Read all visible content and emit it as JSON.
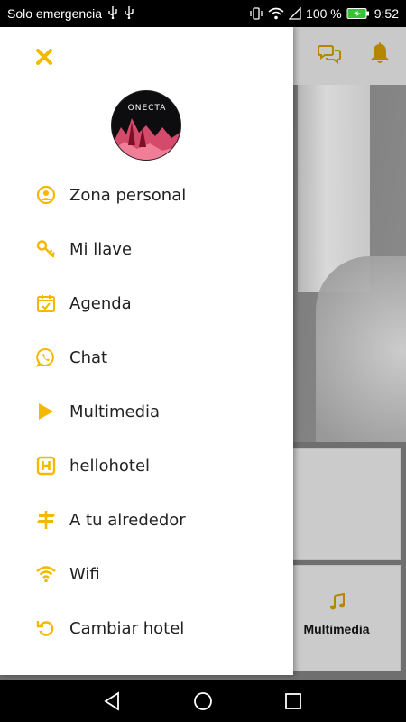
{
  "status_bar": {
    "carrier": "Solo emergencia",
    "battery": "100 %",
    "time": "9:52"
  },
  "accent_color": "#f5b800",
  "app": {
    "tiles": [
      {
        "label": "",
        "icon": ""
      },
      {
        "label": "Multimedia",
        "icon": "music-note-icon"
      }
    ]
  },
  "drawer": {
    "logo_text": "ONECTA",
    "menu": [
      {
        "label": "Zona personal",
        "icon": "user-circle-icon"
      },
      {
        "label": "Mi llave",
        "icon": "key-icon"
      },
      {
        "label": "Agenda",
        "icon": "calendar-check-icon"
      },
      {
        "label": "Chat",
        "icon": "whatsapp-icon"
      },
      {
        "label": "Multimedia",
        "icon": "play-icon"
      },
      {
        "label": "hellohotel",
        "icon": "hotel-h-icon"
      },
      {
        "label": "A tu alrededor",
        "icon": "signpost-icon"
      },
      {
        "label": "Wifi",
        "icon": "wifi-icon"
      },
      {
        "label": "Cambiar hotel",
        "icon": "refresh-icon"
      }
    ]
  }
}
